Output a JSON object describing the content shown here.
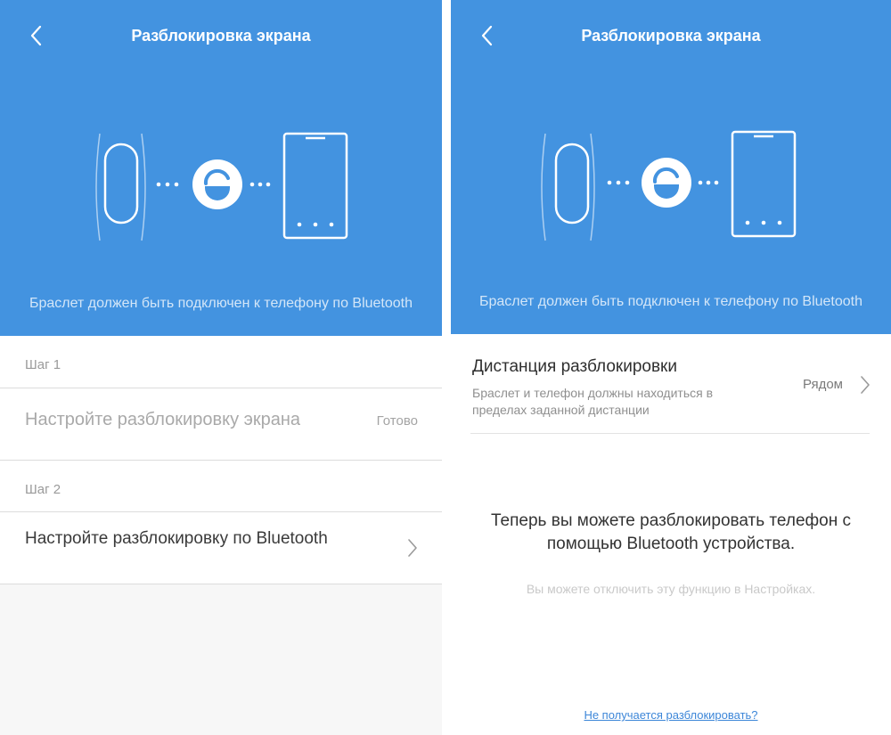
{
  "colors": {
    "header_blue": "#4393e0",
    "link_blue": "#3c86d8",
    "divider": "#dcdcdc"
  },
  "icons": {
    "back": "chevron-left-icon",
    "band": "fitness-band-icon",
    "lock": "unlocked-padlock-icon",
    "phone": "smartphone-icon",
    "row_arrow": "chevron-right-icon"
  },
  "left_screen": {
    "title": "Разблокировка экрана",
    "caption": "Браслет должен быть подключен к телефону по Bluetooth",
    "step1": {
      "header": "Шаг 1",
      "title": "Настройте разблокировку экрана",
      "status": "Готово"
    },
    "step2": {
      "header": "Шаг 2",
      "title": "Настройте разблокировку по Bluetooth"
    }
  },
  "right_screen": {
    "title": "Разблокировка экрана",
    "caption": "Браслет должен быть подключен к телефону по Bluetooth",
    "distance": {
      "title": "Дистанция разблокировки",
      "description": "Браслет и телефон должны находиться в пределах заданной дистанции",
      "value": "Рядом"
    },
    "message": "Теперь вы можете разблокировать телефон с помощью Bluetooth устройства.",
    "hint": "Вы можете отключить эту функцию в Настройках.",
    "help_link": "Не получается разблокировать?"
  }
}
